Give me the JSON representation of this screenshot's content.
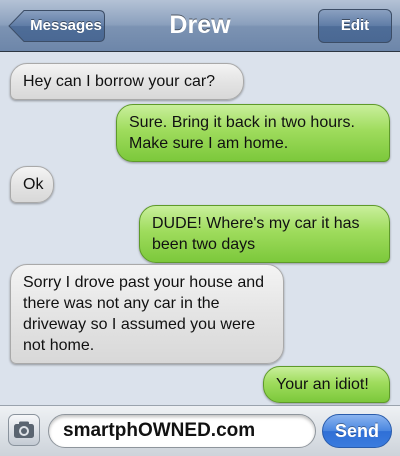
{
  "navbar": {
    "back_label": "Messages",
    "title": "Drew",
    "edit_label": "Edit"
  },
  "messages": [
    {
      "side": "incoming",
      "text": "Hey can I borrow your car?"
    },
    {
      "side": "outgoing",
      "text": "Sure. Bring it back in two hours. Make sure I am home."
    },
    {
      "side": "incoming",
      "text": "Ok"
    },
    {
      "side": "outgoing",
      "text": "DUDE! Where's my car it has been two days"
    },
    {
      "side": "incoming",
      "text": "Sorry I drove past your house and there was not any car in the driveway so I assumed you were not home."
    },
    {
      "side": "outgoing",
      "text": "Your an idiot!"
    }
  ],
  "composer": {
    "camera_icon": "camera-icon",
    "input_value": "smartphOWNED.com",
    "send_label": "Send"
  },
  "colors": {
    "incoming_bubble": "#e4e4e4",
    "outgoing_bubble": "#9fdc5d",
    "background": "#dbe2ec",
    "send_button": "#3b7cde"
  }
}
